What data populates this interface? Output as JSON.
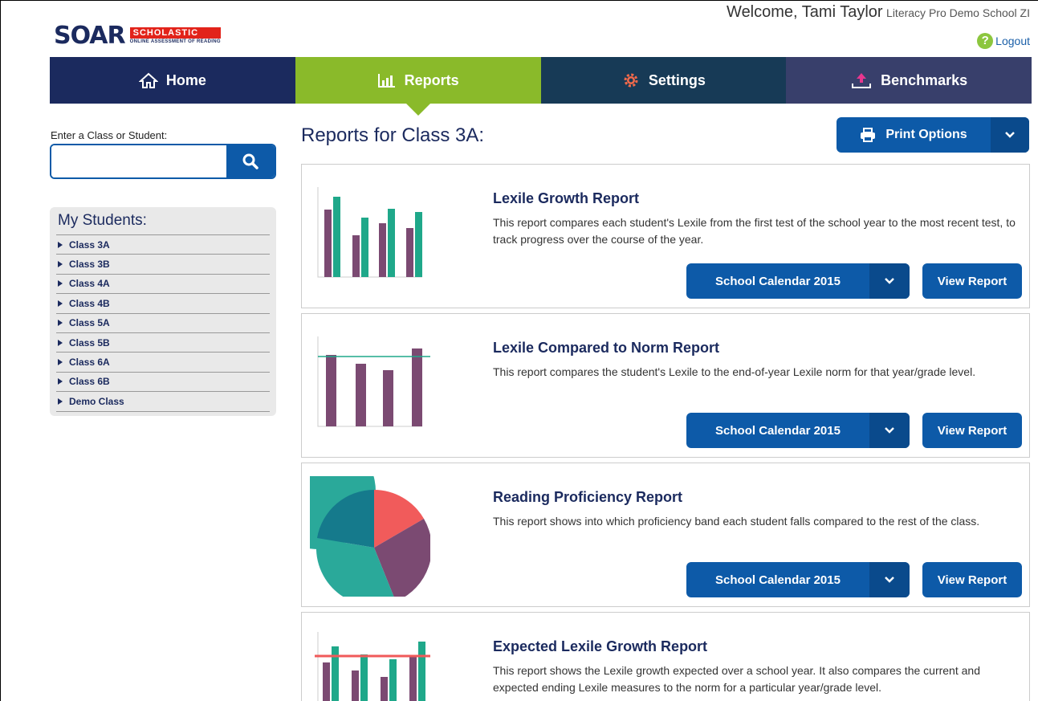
{
  "header": {
    "logo_text": "SOAR",
    "logo_badge": "SCHOLASTIC",
    "logo_sub": "ONLINE ASSESSMENT OF READING",
    "welcome_prefix": "Welcome, ",
    "user_name": "Tami Taylor",
    "school": "Literacy Pro Demo School ZI",
    "logout_label": "Logout"
  },
  "nav": [
    {
      "label": "Home",
      "icon": "home-icon"
    },
    {
      "label": "Reports",
      "icon": "bar-chart-icon"
    },
    {
      "label": "Settings",
      "icon": "gear-icon"
    },
    {
      "label": "Benchmarks",
      "icon": "upload-icon"
    }
  ],
  "sidebar": {
    "search_label": "Enter a Class or Student:",
    "search_placeholder": "",
    "students_title": "My Students:",
    "classes": [
      "Class 3A",
      "Class 3B",
      "Class 4A",
      "Class 4B",
      "Class 5A",
      "Class 5B",
      "Class 6A",
      "Class 6B",
      "Demo Class"
    ]
  },
  "main": {
    "title": "Reports for Class 3A:",
    "print_label": "Print Options",
    "reports": [
      {
        "title": "Lexile Growth Report",
        "description": "This report compares each student's Lexile from the first test of the school year to the most recent test, to track progress over the course of the year.",
        "select_label": "School Calendar 2015",
        "view_label": "View Report"
      },
      {
        "title": "Lexile Compared to Norm Report",
        "description": "This report compares the student's Lexile to the end-of-year Lexile norm for that year/grade level.",
        "select_label": "School Calendar 2015",
        "view_label": "View Report"
      },
      {
        "title": "Reading Proficiency Report",
        "description": "This report shows into which proficiency band each student falls compared to the rest of the class.",
        "select_label": "School Calendar 2015",
        "view_label": "View Report"
      },
      {
        "title": "Expected Lexile Growth Report",
        "description": "This report shows the Lexile growth expected over a school year. It also compares the current and expected ending Lexile measures to the norm for a particular year/grade level."
      }
    ]
  },
  "colors": {
    "navy": "#1b2a5e",
    "green": "#8aba2a",
    "blue_button": "#0d5aa8",
    "purple_bar": "#7b4a72",
    "teal_bar": "#1fa88a",
    "red_line": "#f05a5a"
  }
}
